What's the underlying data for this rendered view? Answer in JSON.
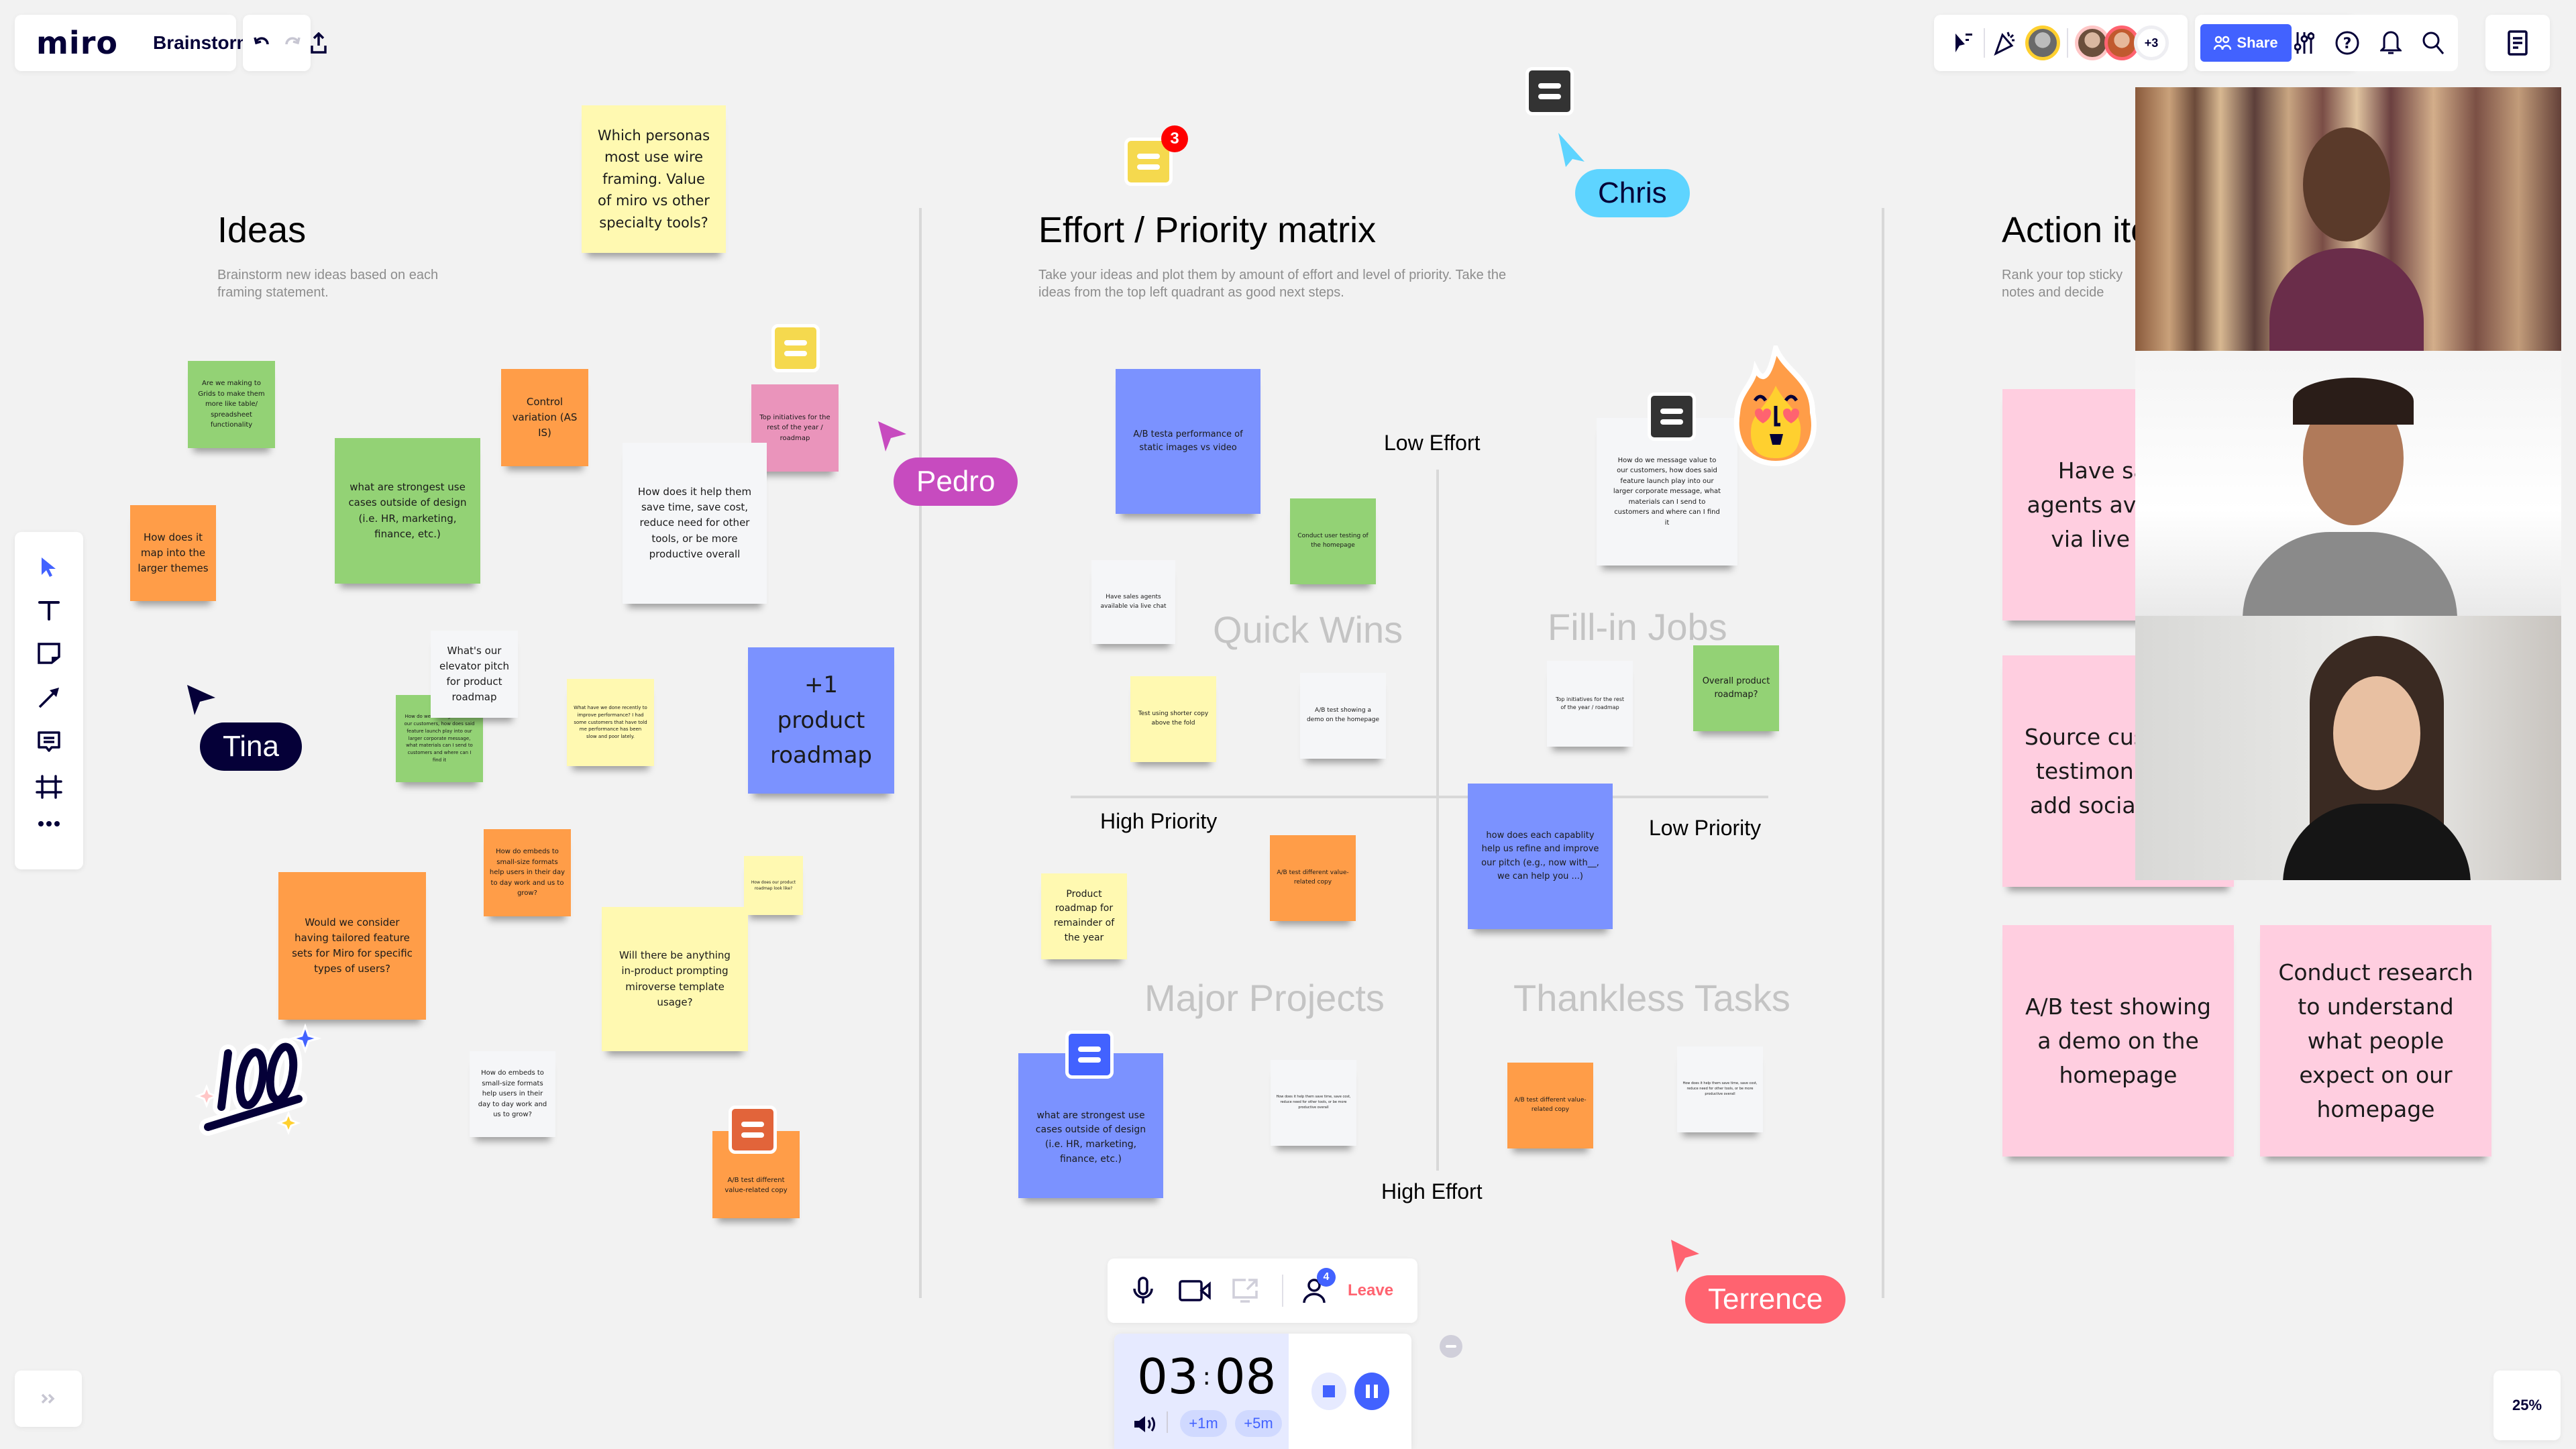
{
  "app": {
    "logo": "miro",
    "board_title": "Brainstorming",
    "zoom_level": "25%",
    "share_label": "Share",
    "extra_collaborators": "+3"
  },
  "toolbar_left": [
    {
      "name": "select-tool",
      "icon": "cursor-arrow-icon",
      "active": true
    },
    {
      "name": "text-tool",
      "icon": "text-t-icon"
    },
    {
      "name": "sticky-note-tool",
      "icon": "sticky-note-icon"
    },
    {
      "name": "connection-line-tool",
      "icon": "arrow-icon"
    },
    {
      "name": "comment-tool",
      "icon": "comment-icon"
    },
    {
      "name": "frame-tool",
      "icon": "frame-icon"
    },
    {
      "name": "more-tools",
      "icon": "more-dots-icon"
    }
  ],
  "frames": {
    "ideas": {
      "title": "Ideas",
      "description": "Brainstorm new ideas based on each framing statement."
    },
    "matrix": {
      "title": "Effort / Priority matrix",
      "description": "Take your ideas and plot them by amount of effort and level of priority. Take the ideas from the top left quadrant as good next steps.",
      "axis": {
        "top": "Low Effort",
        "bottom": "High Effort",
        "left": "High Priority",
        "right": "Low Priority"
      },
      "quadrants": {
        "top_left": "Quick Wins",
        "top_right": "Fill-in Jobs",
        "bottom_left": "Major Projects",
        "bottom_right": "Thankless Tasks"
      }
    },
    "action": {
      "title": "Action items",
      "description": "Rank your top sticky notes and decide what you want to work on."
    }
  },
  "ideas_stickies": [
    "Which personas most use wire framing. Value of miro vs other specialty tools?",
    "Are we making to Grids to make them more like table/ spreadsheet functionality",
    "Control variation (AS IS)",
    "Top initiatives for the rest of the year / roadmap",
    "what are strongest use cases outside of design (i.e. HR, marketing, finance, etc.)",
    "How does it help them save time, save cost, reduce need for other tools, or be more productive overall",
    "How does it map into the larger themes",
    "What's our elevator pitch for product roadmap",
    "How do we message value to our customers, how does said feature launch play into our larger corporate message, what materials can I send to customers and where can I find it",
    "What have we done recently to improve performance? I had some customers that have told me performance has been slow and poor lately.",
    "+1 product roadmap",
    "How do embeds to small-size formats help users in their day to day work and us to grow?",
    "How does our product roadmap look like?",
    "Would we consider having tailored feature sets for Miro for specific types of users?",
    "Will there be anything in-product prompting miroverse template usage?",
    "How do embeds to small-size formats help users in their day to day work and us to grow?",
    "A/B test different value-related copy"
  ],
  "matrix_stickies": [
    "A/B testa performance of static images vs video",
    "Conduct user testing of the homepage",
    "Have sales agents available via live chat",
    "Test using shorter copy above the fold",
    "A/B test showing a demo on the homepage",
    "How do we message value to our customers, how does said feature launch play into our larger corporate message, what materials can I send to customers and where can I find it",
    "Top initiatives for the rest of the year / roadmap",
    "Overall product roadmap?",
    "how does each capablity help us refine and improve our pitch (e.g., now with__, we can help you ...)",
    "Product roadmap for remainder of the year",
    "A/B test different value-related copy",
    "what are strongest use cases outside of design (i.e. HR, marketing, finance, etc.)",
    "How does it help them save time, save cost, reduce need for other tools, or be more productive overall",
    "A/B test different value-related copy",
    "How does it help them save time, save cost, reduce need for other tools, or be more productive overall"
  ],
  "action_stickies": [
    "Have sales agents available via live chat",
    "Source customer testimonials to add social proof",
    "A/B test showing a demo on the homepage",
    "Conduct research to understand what people expect on our homepage"
  ],
  "cursors": [
    {
      "name": "Tina",
      "color": "#050038",
      "text_color": "#ffffff"
    },
    {
      "name": "Pedro",
      "color": "#c74bbf",
      "text_color": "#ffffff"
    },
    {
      "name": "Chris",
      "color": "#5ed4ff",
      "text_color": "#050038"
    },
    {
      "name": "Terrence",
      "color": "#ff6370",
      "text_color": "#ffffff"
    }
  ],
  "comments": {
    "unread_badge": "3"
  },
  "call_bar": {
    "participants_count": "4",
    "leave_label": "Leave"
  },
  "timer": {
    "minutes": "03",
    "seconds": "08",
    "add_1m": "+1m",
    "add_5m": "+5m"
  },
  "video_tiles": [
    {
      "participant": "participant-1"
    },
    {
      "participant": "participant-2"
    },
    {
      "participant": "participant-3"
    }
  ]
}
